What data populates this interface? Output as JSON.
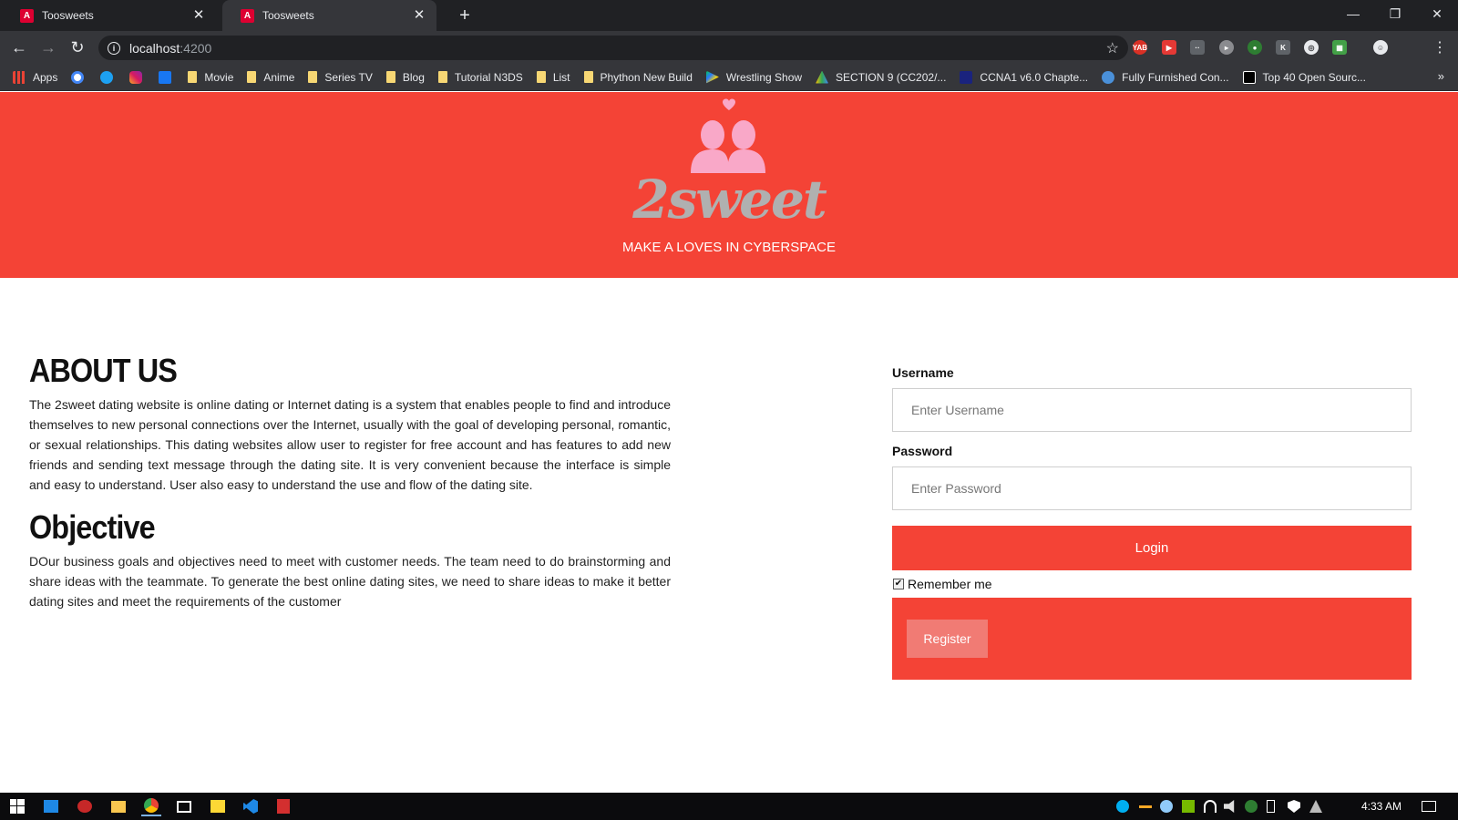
{
  "browser": {
    "tabs": [
      {
        "title": "Toosweets",
        "active": false
      },
      {
        "title": "Toosweets",
        "active": true
      }
    ],
    "url_host": "localhost",
    "url_port": ":4200",
    "bookmarks": [
      {
        "label": "Apps",
        "icon": "apps-grid-icon"
      },
      {
        "label": "",
        "icon": "google-icon"
      },
      {
        "label": "",
        "icon": "twitter-icon"
      },
      {
        "label": "",
        "icon": "instagram-icon"
      },
      {
        "label": "",
        "icon": "facebook-icon"
      },
      {
        "label": "Movie",
        "icon": "folder-icon"
      },
      {
        "label": "Anime",
        "icon": "folder-icon"
      },
      {
        "label": "Series TV",
        "icon": "folder-icon"
      },
      {
        "label": "Blog",
        "icon": "folder-icon"
      },
      {
        "label": "Tutorial N3DS",
        "icon": "folder-icon"
      },
      {
        "label": "List",
        "icon": "folder-icon"
      },
      {
        "label": "Phython New Build",
        "icon": "folder-icon"
      },
      {
        "label": "Wrestling Show",
        "icon": "play-store-icon"
      },
      {
        "label": "SECTION 9 (CC202/...",
        "icon": "drive-icon"
      },
      {
        "label": "CCNA1 v6.0 Chapte...",
        "icon": "site-icon"
      },
      {
        "label": "Fully Furnished Con...",
        "icon": "site-icon"
      },
      {
        "label": "Top 40 Open Sourc...",
        "icon": "site-icon"
      }
    ],
    "bookmarks_more": "»"
  },
  "hero": {
    "logo_text": "2sweet",
    "tagline": "MAKE A LOVES IN CYBERSPACE",
    "background": "#f44336",
    "logo_pink": "#f9a8c8"
  },
  "about": {
    "title": "ABOUT US",
    "body": "The 2sweet dating website is online dating or Internet dating is a system that enables people to find and introduce themselves to new personal connections over the Internet, usually with the goal of developing personal, romantic, or sexual relationships. This dating websites allow user to register for free account and has features to add new friends and sending text message through the dating site. It is very convenient because the interface is simple and easy to understand. User also easy to understand the use and flow of the dating site.",
    "objective_title": "Objective",
    "objective_body": "DOur business goals and objectives need to meet with customer needs. The team need to do brainstorming and share ideas with the teammate. To generate the best online dating sites, we need to share ideas to make it better dating sites and meet the requirements of the customer"
  },
  "login": {
    "username_label": "Username",
    "username_placeholder": "Enter Username",
    "password_label": "Password",
    "password_placeholder": "Enter Password",
    "login_button": "Login",
    "remember_label": "Remember me",
    "remember_checked": true,
    "register_button": "Register"
  },
  "taskbar": {
    "time": "4:33 AM"
  }
}
